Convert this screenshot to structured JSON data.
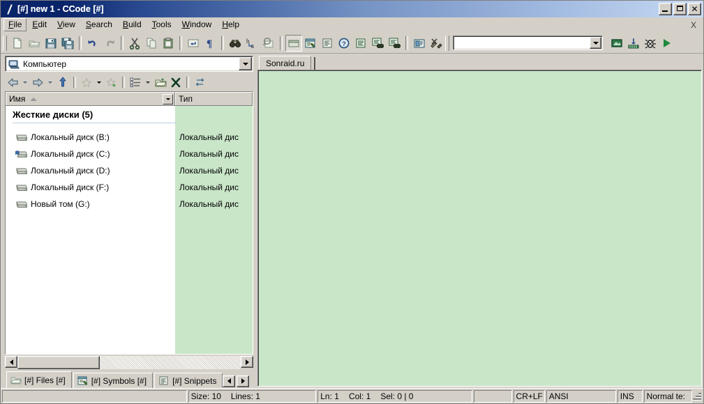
{
  "window": {
    "title": "[#] new 1 - CCode [#]",
    "icon": "slash-icon",
    "buttons": {
      "minimize": "minimize-icon",
      "maximize": "maximize-icon",
      "close": "✕"
    }
  },
  "menubar": {
    "items": [
      {
        "label": "File",
        "accel": "F",
        "focused": true
      },
      {
        "label": "Edit",
        "accel": "E",
        "focused": false
      },
      {
        "label": "View",
        "accel": "V",
        "focused": false
      },
      {
        "label": "Search",
        "accel": "S",
        "focused": false
      },
      {
        "label": "Build",
        "accel": "B",
        "focused": false
      },
      {
        "label": "Tools",
        "accel": "T",
        "focused": false
      },
      {
        "label": "Window",
        "accel": "W",
        "focused": false
      },
      {
        "label": "Help",
        "accel": "H",
        "focused": false
      }
    ],
    "close_document": "X"
  },
  "toolbar": {
    "buttons": [
      "new-file-icon",
      "open-file-icon",
      "save-icon",
      "save-all-icon",
      "undo-icon",
      "redo-icon",
      "cut-icon",
      "copy-icon",
      "paste-icon",
      "insert-newline-icon",
      "pilcrow-icon",
      "find-icon",
      "replace-icon",
      "find-in-files-icon",
      "toggle-explorer-icon",
      "symbols-panel-icon",
      "snippets-panel-icon",
      "help-icon",
      "output-panel-icon",
      "find-results-1-icon",
      "find-results-2-icon",
      "properties-icon",
      "tools-options-icon",
      "compile-icon",
      "build-icon",
      "debug-icon",
      "run-icon"
    ],
    "combo": {
      "value": "",
      "placeholder": ""
    }
  },
  "file_panel": {
    "location": {
      "label": "Компьютер",
      "icon": "computer-icon"
    },
    "nav_buttons": [
      "back-icon",
      "back-history-dropdown-icon",
      "forward-icon",
      "forward-history-dropdown-icon",
      "up-one-level-icon",
      "favorites-icon",
      "favorites-dropdown-icon",
      "add-favorite-icon",
      "views-icon",
      "views-dropdown-icon",
      "new-folder-icon",
      "delete-icon",
      "refresh-sync-icon"
    ],
    "columns": [
      {
        "label": "Имя",
        "sort": "asc"
      },
      {
        "label": "Тип",
        "sort": "none"
      }
    ],
    "group_header": "Жесткие диски (5)",
    "rows": [
      {
        "name": "Локальный диск (B:)",
        "type": "Локальный дис",
        "icon": "hard-drive-icon"
      },
      {
        "name": "Локальный диск (C:)",
        "type": "Локальный дис",
        "icon": "system-drive-icon"
      },
      {
        "name": "Локальный диск (D:)",
        "type": "Локальный дис",
        "icon": "hard-drive-icon"
      },
      {
        "name": "Локальный диск (F:)",
        "type": "Локальный дис",
        "icon": "hard-drive-icon"
      },
      {
        "name": "Новый том (G:)",
        "type": "Локальный дис",
        "icon": "hard-drive-icon"
      }
    ],
    "tabs": [
      {
        "label": "[#] Files [#]",
        "icon": "files-icon",
        "active": true
      },
      {
        "label": "[#] Symbols [#]",
        "icon": "symbols-icon",
        "active": false
      },
      {
        "label": "[#] Snippets",
        "icon": "snippets-icon",
        "active": false
      }
    ],
    "tab_scroll": {
      "left": "scroll-left-icon",
      "right": "scroll-right-icon"
    }
  },
  "editor": {
    "tabs": [
      {
        "label": "Sonraid.ru",
        "active": true
      }
    ],
    "content": "",
    "background": "#c9e6c9"
  },
  "statusbar": {
    "message": "",
    "size": "Size: 10",
    "lines": "Lines: 1",
    "ln": "Ln: 1",
    "col": "Col: 1",
    "sel": "Sel: 0 | 0",
    "spare": "",
    "eol": "CR+LF",
    "encoding": "ANSI",
    "insert_mode": "INS",
    "doc_type": "Normal te:"
  },
  "colors": {
    "title_start": "#0a246a",
    "title_end": "#cddcf3",
    "face": "#d4d0c8",
    "editor_bg": "#c9e6c9",
    "text": "#000000"
  }
}
